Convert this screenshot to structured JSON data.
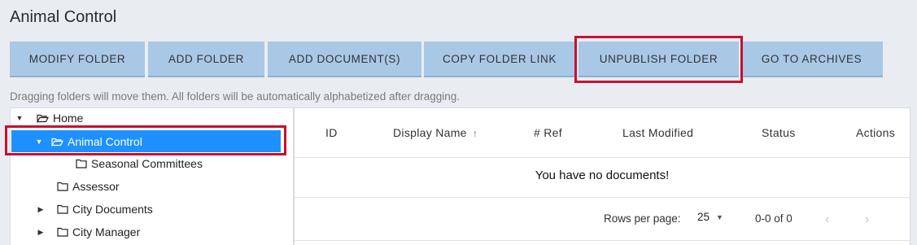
{
  "page": {
    "title": "Animal Control"
  },
  "toolbar": {
    "modify": "MODIFY FOLDER",
    "add_folder": "ADD FOLDER",
    "add_docs": "ADD DOCUMENT(S)",
    "copy_link": "COPY FOLDER LINK",
    "unpublish": "UNPUBLISH FOLDER",
    "archives": "GO TO ARCHIVES"
  },
  "hint": "Dragging folders will move them. All folders will be automatically alphabetized after dragging.",
  "tree": {
    "home": "Home",
    "animal_control": "Animal Control",
    "seasonal": "Seasonal Committees",
    "assessor": "Assessor",
    "city_documents": "City Documents",
    "city_manager": "City Manager"
  },
  "table": {
    "columns": [
      "ID",
      "Display Name",
      "# Ref",
      "Last Modified",
      "Status",
      "Actions"
    ],
    "sort_indicator": "↑",
    "empty_message": "You have no documents!"
  },
  "pagination": {
    "rows_label": "Rows per page:",
    "rows_value": "25",
    "range": "0-0 of 0"
  },
  "colors": {
    "button_bg": "#a9c8e6",
    "highlight": "#c8102e",
    "selected_bg": "#1e90ff"
  }
}
